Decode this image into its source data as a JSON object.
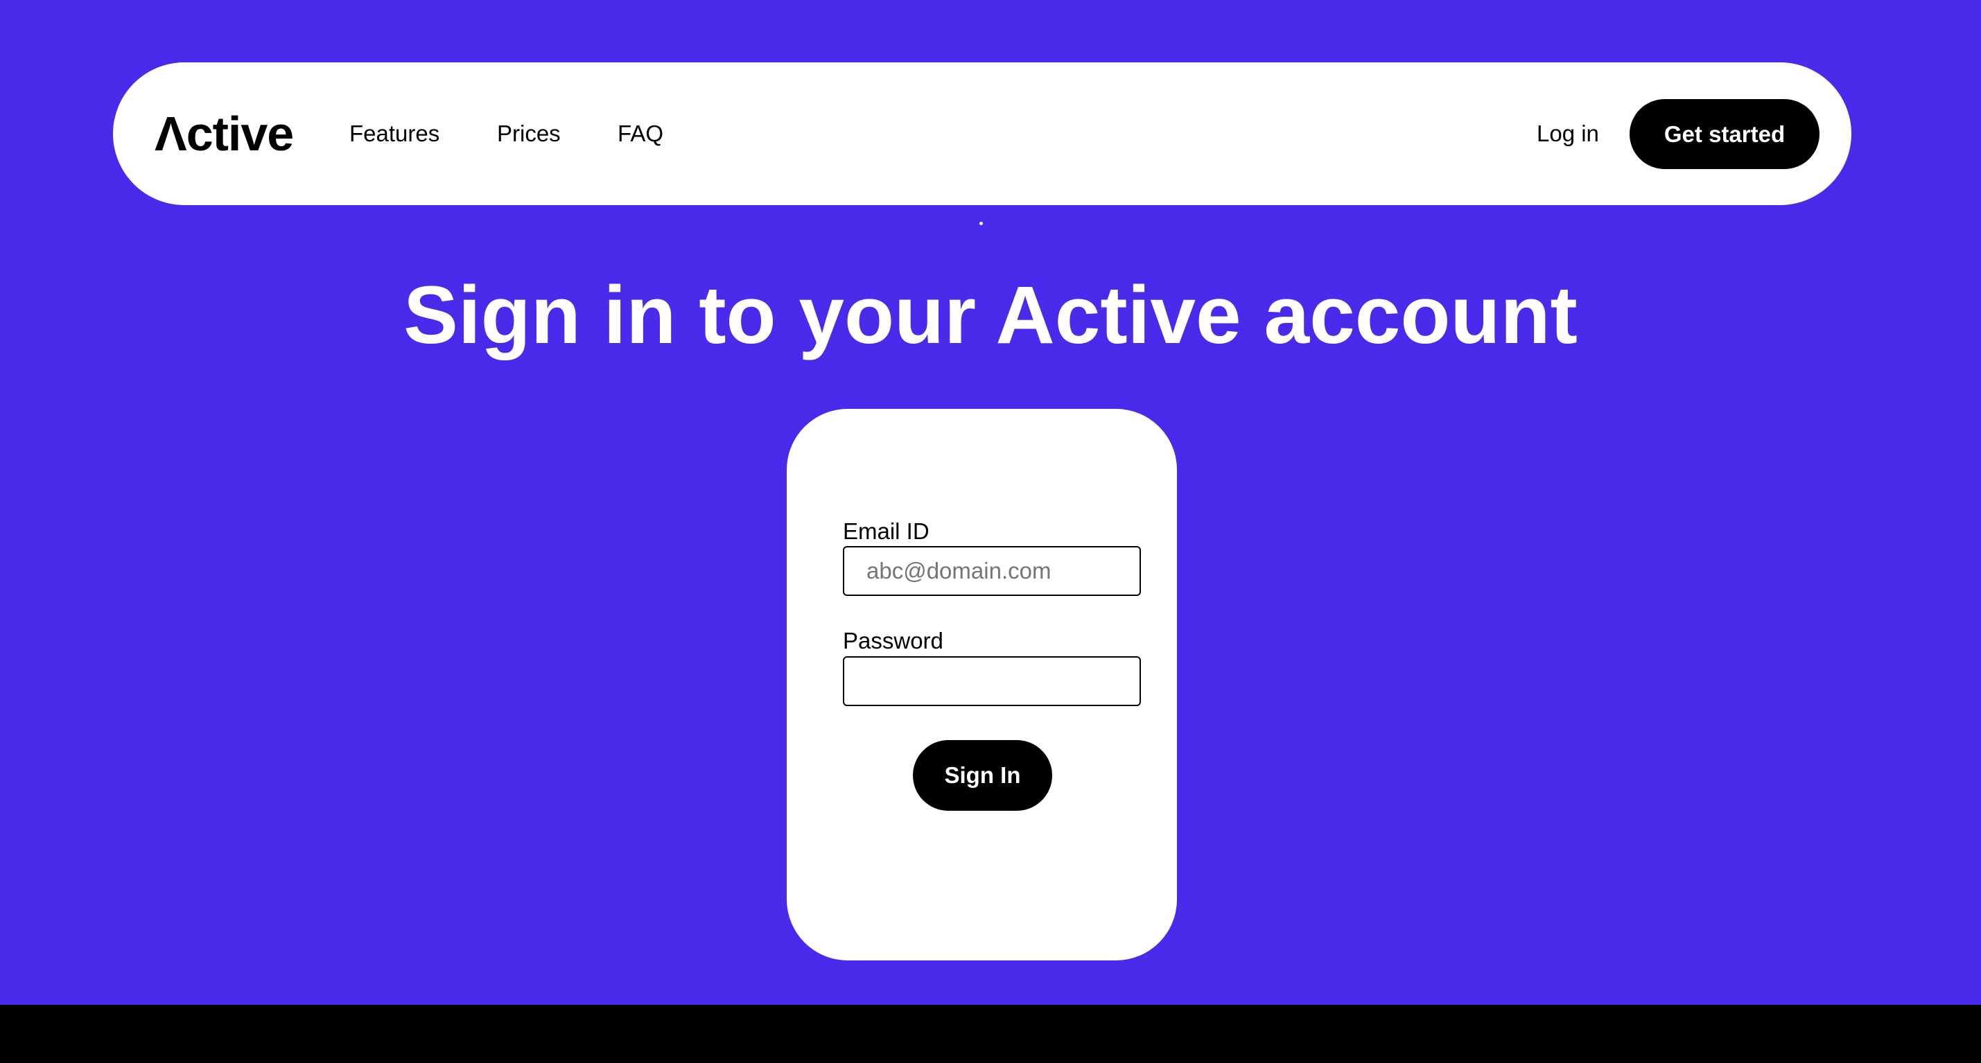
{
  "colors": {
    "background": "#4b2aec",
    "surface": "#ffffff",
    "primary_button": "#000000",
    "footer": "#000000"
  },
  "navbar": {
    "logo": "Λctive",
    "links": [
      "Features",
      "Prices",
      "FAQ"
    ],
    "login_label": "Log in",
    "cta_label": "Get started"
  },
  "main": {
    "title": "Sign in to your Active account"
  },
  "form": {
    "email_label": "Email ID",
    "email_placeholder": "abc@domain.com",
    "email_value": "",
    "password_label": "Password",
    "password_value": "",
    "submit_label": "Sign In"
  }
}
